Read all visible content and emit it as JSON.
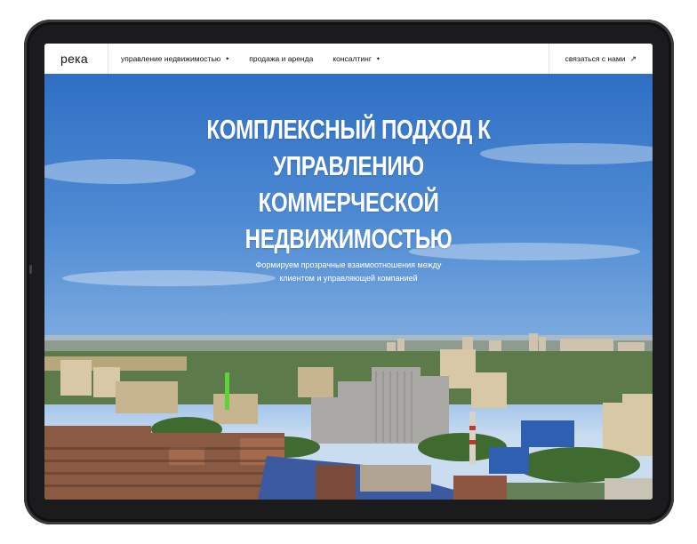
{
  "nav": {
    "logo": "река",
    "items": [
      {
        "label": "управление недвижимостью",
        "has_dropdown": true
      },
      {
        "label": "продажа и аренда",
        "has_dropdown": false
      },
      {
        "label": "консалтинг",
        "has_dropdown": true
      }
    ],
    "dropdown_glyph": "✦",
    "contact_label": "связаться с нами",
    "contact_arrow": "↗"
  },
  "hero": {
    "title_lines": [
      "КОМПЛЕКСНЫЙ ПОДХОД К",
      "УПРАВЛЕНИЮ КОММЕРЧЕСКОЙ",
      "НЕДВИЖИМОСТЬЮ"
    ],
    "subtitle_lines": [
      "Формируем прозрачные взаимоотношения между",
      "клиентом и управляющей компанией"
    ]
  },
  "colors": {
    "sky_top": "#2f6fc4",
    "sky_horizon": "#c9dcf0",
    "device_frame": "#1b1b1d",
    "nav_bg": "#ffffff",
    "hero_text": "#ffffff"
  }
}
